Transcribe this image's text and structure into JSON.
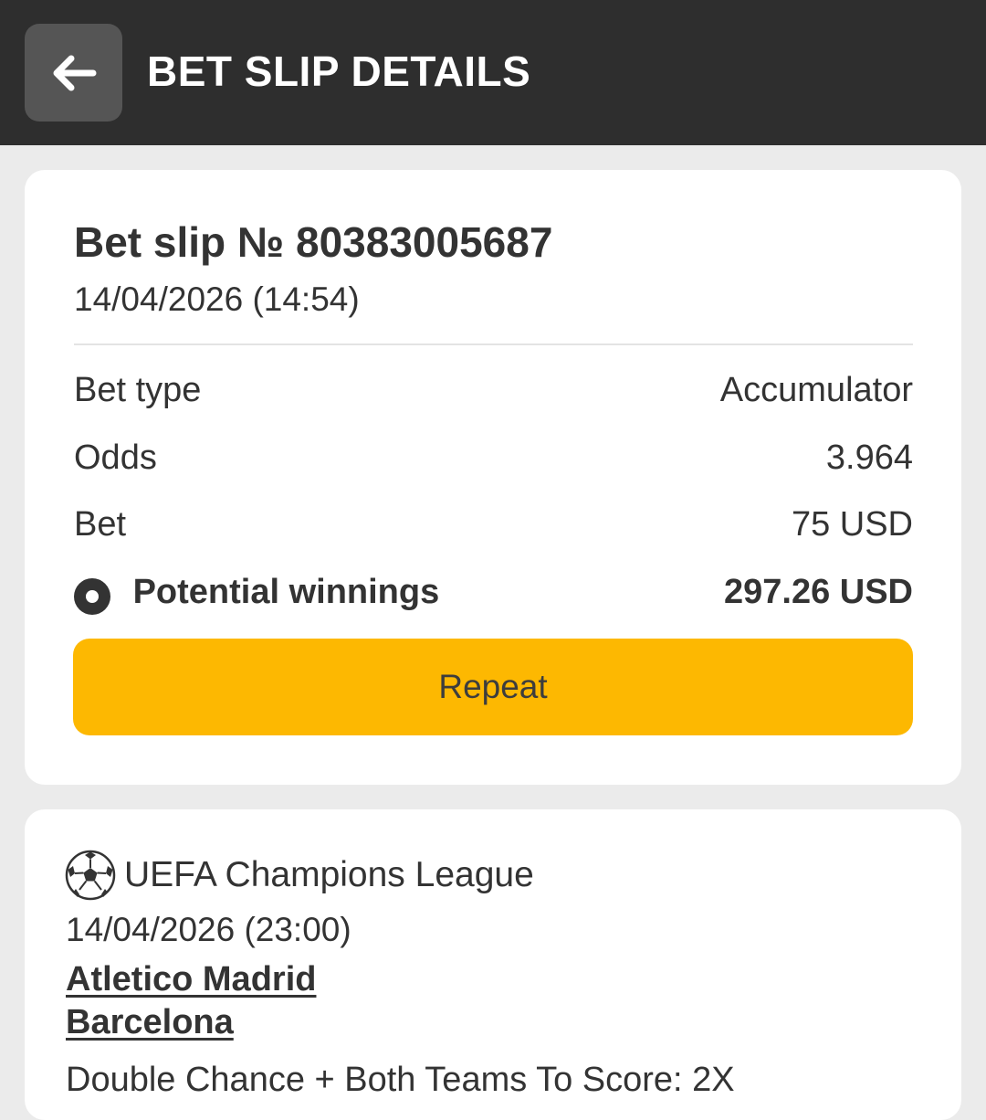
{
  "header": {
    "title": "BET SLIP DETAILS",
    "back_icon": "arrow-left-icon"
  },
  "slip": {
    "title": "Bet slip № 80383005687",
    "date": "14/04/2026 (14:54)",
    "rows": {
      "bet_type": {
        "label": "Bet type",
        "value": "Accumulator"
      },
      "odds": {
        "label": "Odds",
        "value": "3.964"
      },
      "bet": {
        "label": "Bet",
        "value": "75 USD"
      },
      "potential_winnings": {
        "label": "Potential winnings",
        "value": "297.26 USD"
      }
    },
    "repeat_label": "Repeat"
  },
  "event": {
    "sport_icon": "soccer-ball-icon",
    "league": "UEFA Champions League",
    "date": "14/04/2026 (23:00)",
    "team1": "Atletico Madrid",
    "team2": "Barcelona",
    "market": "Double Chance + Both Teams To Score: 2X"
  },
  "colors": {
    "header_bg": "#2e2e2e",
    "page_bg": "#ebebeb",
    "accent": "#fdb801",
    "text": "#333333"
  }
}
